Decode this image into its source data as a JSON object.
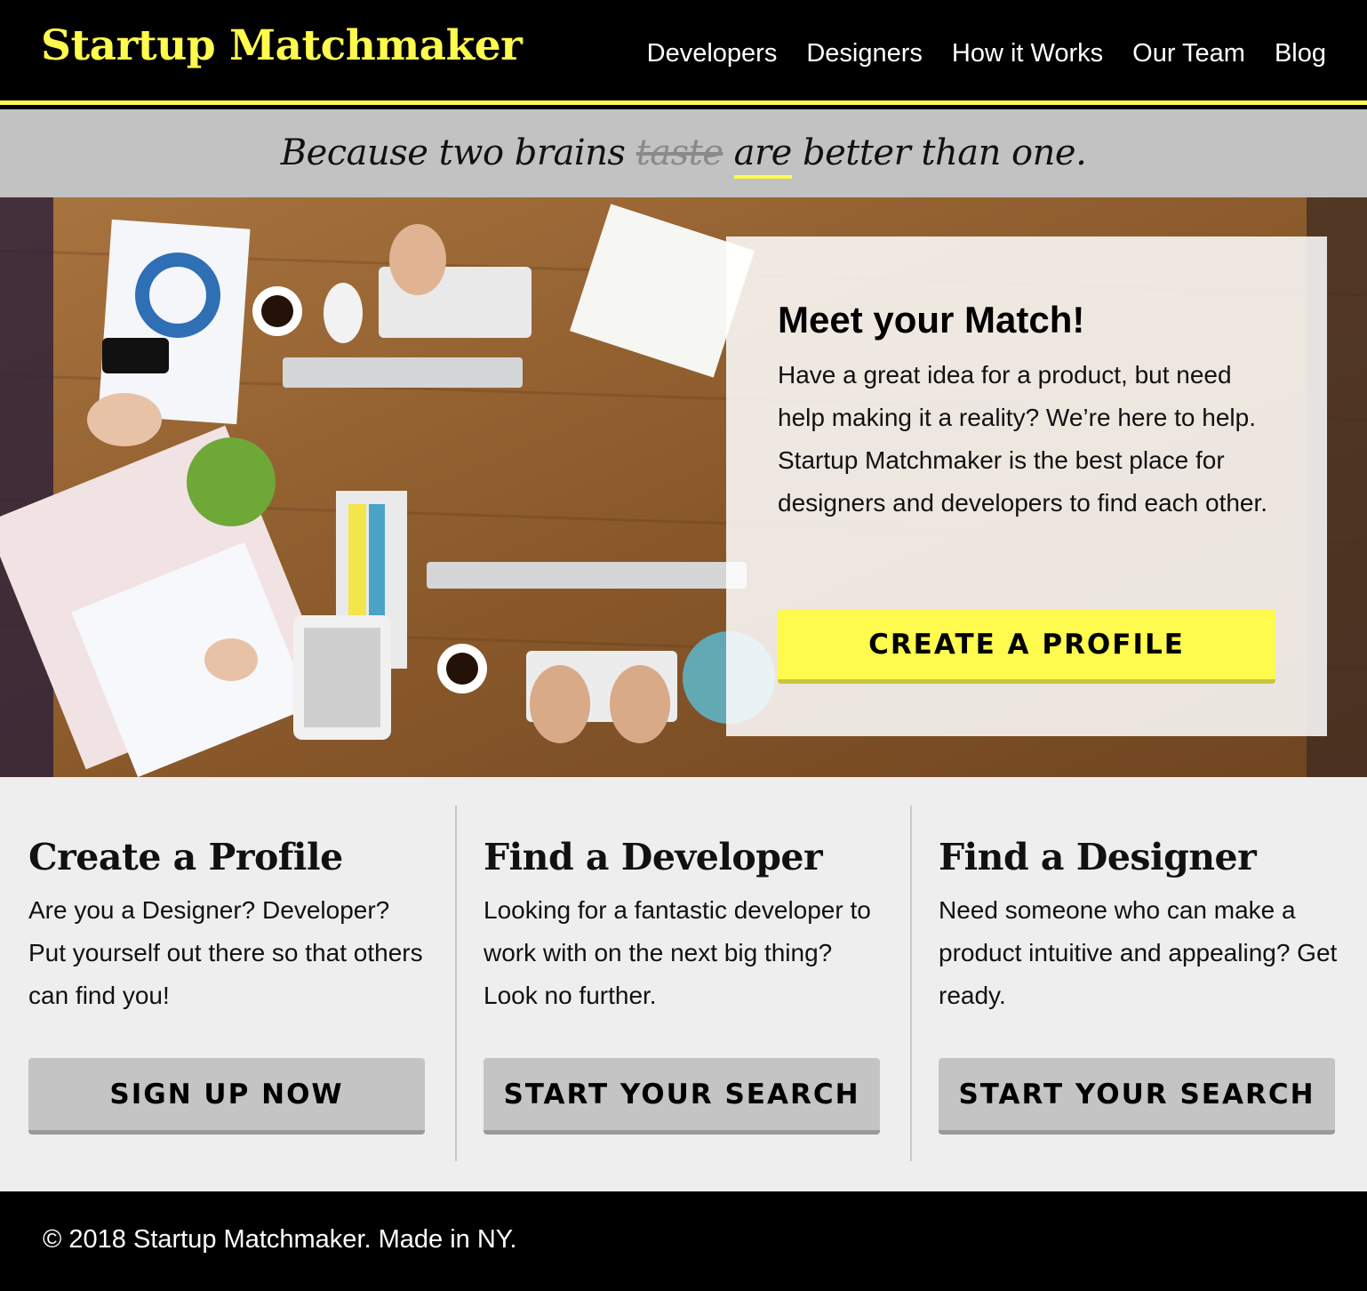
{
  "header": {
    "logo": "Startup Matchmaker",
    "nav": [
      "Developers",
      "Designers",
      "How it Works",
      "Our Team",
      "Blog"
    ]
  },
  "tagline": {
    "before": "Because two brains ",
    "strikethrough": "taste",
    "highlighted": "are",
    "after": " better than one."
  },
  "hero": {
    "title": "Meet your Match!",
    "body": "Have a great idea for a product, but need help making it a reality? We’re here to help. Startup Matchmaker is the best place for designers and developers to find each other.",
    "button": "CREATE A PROFILE"
  },
  "features": [
    {
      "title": "Create a Profile",
      "body": "Are you a Designer? Developer? Put yourself out there so that others can find you!",
      "button": "SIGN UP NOW"
    },
    {
      "title": "Find a Developer",
      "body": "Looking for a fantastic developer to work with on the next big thing? Look no further.",
      "button": "START YOUR SEARCH"
    },
    {
      "title": "Find a Designer",
      "body": "Need someone who can make a product intuitive and appealing? Get ready.",
      "button": "START YOUR SEARCH"
    }
  ],
  "footer": {
    "text": "© 2018 Startup Matchmaker. Made in NY."
  },
  "colors": {
    "accent": "#fefa4e",
    "header_bg": "#000000",
    "tagline_bg": "#c2c2c2",
    "features_bg": "#eeeeee",
    "button_gray": "#c4c4c4"
  }
}
